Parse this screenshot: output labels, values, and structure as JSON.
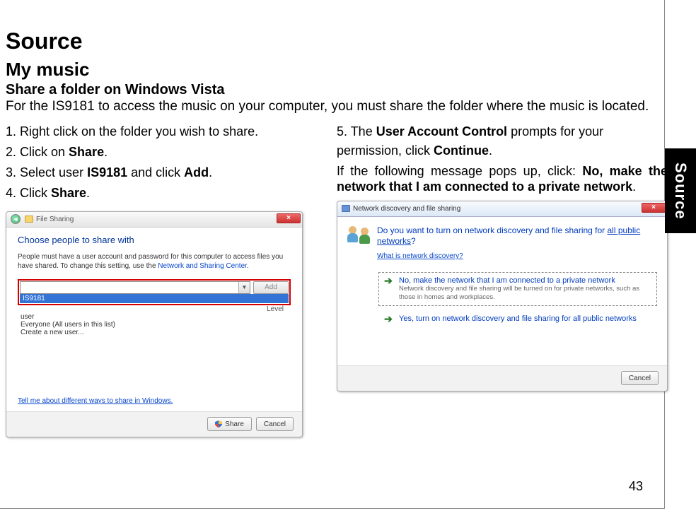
{
  "page": {
    "title": "Source",
    "subtitle": "My music",
    "section": "Share a folder on Windows Vista",
    "intro": "For the IS9181 to access the music on your computer, you must share the folder where the music is located.",
    "page_number": "43",
    "side_tab": "Source"
  },
  "left": {
    "step1": "Right click on the folder you wish to share.",
    "step2_pre": "Click on ",
    "step2_bold": "Share",
    "step3_pre": "Select user ",
    "step3_b1": "IS9181",
    "step3_mid": " and click ",
    "step3_b2": "Add",
    "step4_pre": "Click ",
    "step4_bold": "Share"
  },
  "right": {
    "step5_pre": "The ",
    "step5_b1": "User Account Control",
    "step5_mid": " prompts for your permission, click ",
    "step5_b2": "Continue",
    "followup_pre": "If the following message pops up, click: ",
    "followup_bold": "No, make the network that I am connected to a private network"
  },
  "dlg1": {
    "title": "File Sharing",
    "heading": "Choose people to share with",
    "sub_pre": "People must have a user account and password for this computer to access files you have shared. To change this setting, use the ",
    "sub_link": "Network and Sharing Center",
    "add": "Add",
    "selected": "IS9181",
    "col_level": "Level",
    "row_user": "user",
    "row_everyone": "Everyone (All users in this list)",
    "row_create": "Create a new user...",
    "help": "Tell me about different ways to share in Windows.",
    "btn_share": "Share",
    "btn_cancel": "Cancel",
    "close": "×"
  },
  "dlg2": {
    "title": "Network discovery and file sharing",
    "question_pre": "Do you want to turn on network discovery and file sharing for ",
    "question_link": "all public networks",
    "question_post": "?",
    "whatis": "What is network discovery?",
    "opt1_title": "No, make the network that I am connected to a private network",
    "opt1_sub": "Network discovery and file sharing will be turned on for private networks, such as those in homes and workplaces.",
    "opt2_title": "Yes, turn on network discovery and file sharing for all public networks",
    "btn_cancel": "Cancel",
    "close": "×"
  }
}
